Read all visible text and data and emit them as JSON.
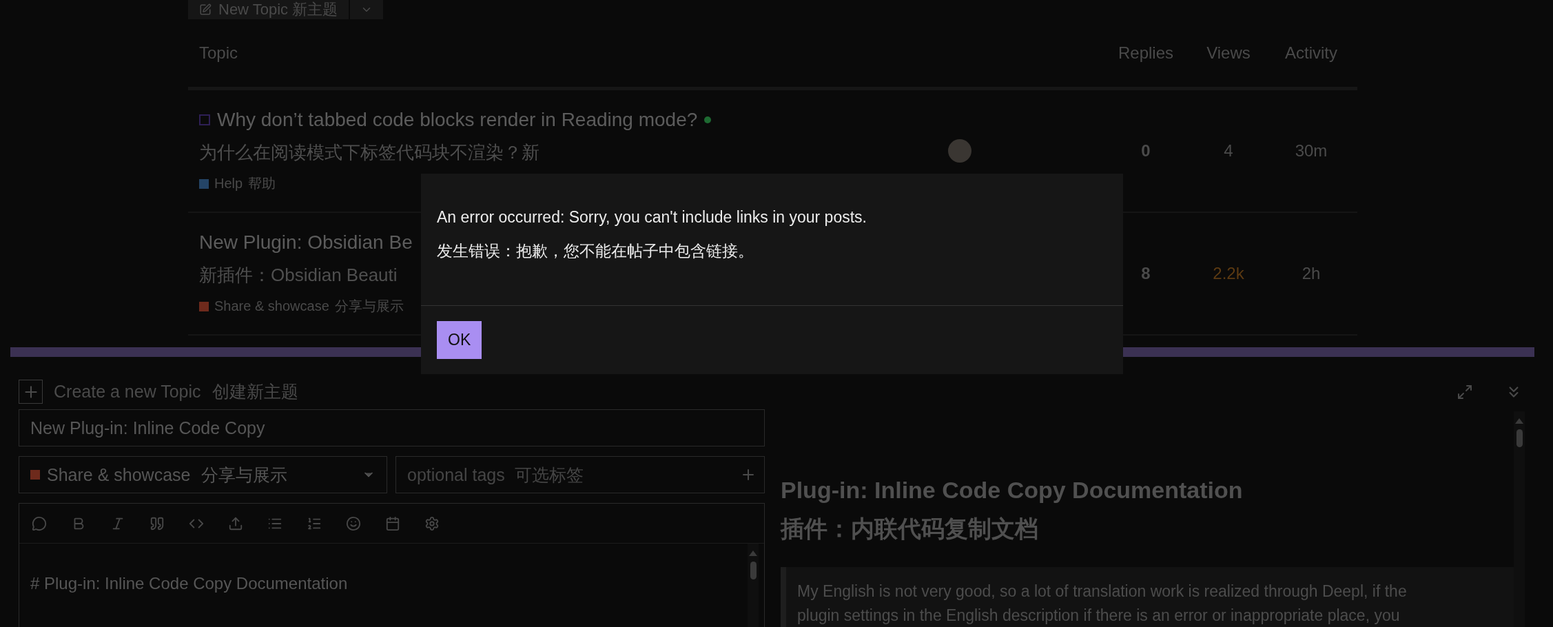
{
  "new_topic_button": {
    "label": "New Topic",
    "label_zh": "新主题"
  },
  "table": {
    "columns": [
      "Topic",
      "Replies",
      "Views",
      "Activity"
    ],
    "rows": [
      {
        "title": "Why don’t tabbed code blocks render in Reading mode?",
        "new": true,
        "subtitle": "为什么在阅读模式下标签代码块不渲染？新",
        "category": {
          "name": "Help",
          "name_zh": "帮助",
          "color": "#244466"
        },
        "replies": "0",
        "views": "4",
        "views_hot": false,
        "activity": "30m",
        "avatar": true
      },
      {
        "title": "New Plugin: Obsidian Be",
        "new": false,
        "subtitle": "新插件：Obsidian Beauti",
        "category": {
          "name": "Share & showcase",
          "name_zh": "分享与展示",
          "color": "#6e2a1c"
        },
        "replies": "8",
        "views": "2.2k",
        "views_hot": true,
        "activity": "2h",
        "avatar": false
      }
    ]
  },
  "modal": {
    "lines": [
      "An error occurred: Sorry, you can't include links in your posts.",
      "发生错误：抱歉，您不能在帖子中包含链接。"
    ],
    "button": "OK"
  },
  "composer": {
    "title": "Create a new Topic",
    "title_zh": "创建新主题",
    "topic_title": "New Plug-in: Inline Code Copy",
    "category": {
      "name": "Share & showcase",
      "name_zh": "分享与展示",
      "color": "#6e2a1c"
    },
    "tags_placeholder": "optional tags  可选标签",
    "editor_lines": [
      "# Plug-in: Inline Code Copy Documentation"
    ],
    "preview": {
      "heading": [
        "Plug-in: Inline Code Copy Documentation",
        "插件：内联代码复制文档"
      ],
      "quote_lines": [
        "My English is not very good, so a lot of translation work is realized through Deepl, if the",
        "plugin settings in the English description if there is an error or inappropriate place, you"
      ]
    }
  }
}
